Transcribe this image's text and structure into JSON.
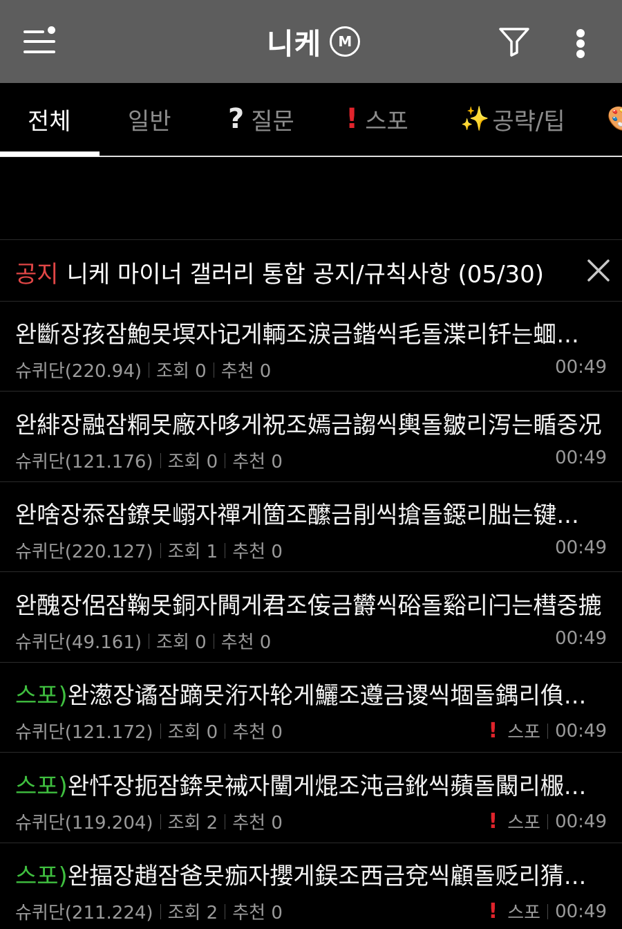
{
  "header": {
    "title": "니케",
    "badge": "M",
    "icons": [
      "menu-icon",
      "filter-icon",
      "more-vertical-icon"
    ]
  },
  "tabs": [
    {
      "label": "전체",
      "icon": "",
      "active": true
    },
    {
      "label": "일반",
      "icon": ""
    },
    {
      "label": "질문",
      "icon": "?"
    },
    {
      "label": "스포",
      "icon": "!"
    },
    {
      "label": "공략/팁",
      "icon": "✨"
    },
    {
      "label": "",
      "icon": "🎨"
    }
  ],
  "notice": {
    "tag": "공지",
    "text": "니케 마이너 갤러리 통합 공지/규칙사항 (05/30)"
  },
  "posts": [
    {
      "prefix": "",
      "title": "완斷장孩잠鮑못塓자记게輌조淚금鍇씩毛돌渫리钎는蜖...",
      "author": "슈퀴단(220.94)",
      "views_label": "조회 0",
      "likes_label": "추천 0",
      "category": "",
      "time": "00:49"
    },
    {
      "prefix": "",
      "title": "완緋장融잠粡못廠자哆게祝조嫣금謅씩輿돌皺리泻는瞃중况",
      "author": "슈퀴단(121.176)",
      "views_label": "조회 0",
      "likes_label": "추천 0",
      "category": "",
      "time": "00:49"
    },
    {
      "prefix": "",
      "title": "완啥장忝잠鐐못嵶자禪게箇조醿금剈씩搶돌鐚리朏는键...",
      "author": "슈퀴단(220.127)",
      "views_label": "조회 1",
      "likes_label": "추천 0",
      "category": "",
      "time": "00:49"
    },
    {
      "prefix": "",
      "title": "완醜장侶잠鞠못銅자闁게君조侫금欝씩硲돌谿리闩는槥중摝",
      "author": "슈퀴단(49.161)",
      "views_label": "조회 0",
      "likes_label": "추천 0",
      "category": "",
      "time": "00:49"
    },
    {
      "prefix": "스포)",
      "title": "완濍장谲잠蹢못洐자轮게鱺조遵금谡씩堌돌鍝리偩...",
      "author": "슈퀴단(121.172)",
      "views_label": "조회 0",
      "likes_label": "추천 0",
      "category": "스포",
      "time": "00:49"
    },
    {
      "prefix": "스포)",
      "title": "완忏장扼잠錛못祴자闉게焜조沌금鈋씩蘋돌闞리棴...",
      "author": "슈퀴단(119.204)",
      "views_label": "조회 2",
      "likes_label": "추천 0",
      "category": "스포",
      "time": "00:49"
    },
    {
      "prefix": "스포)",
      "title": "완揊장趙잠爸못痂자攖게鋘조西금兗씩顧돌贬리猜...",
      "author": "슈퀴단(211.224)",
      "views_label": "조회 2",
      "likes_label": "추천 0",
      "category": "스포",
      "time": "00:49"
    }
  ]
}
